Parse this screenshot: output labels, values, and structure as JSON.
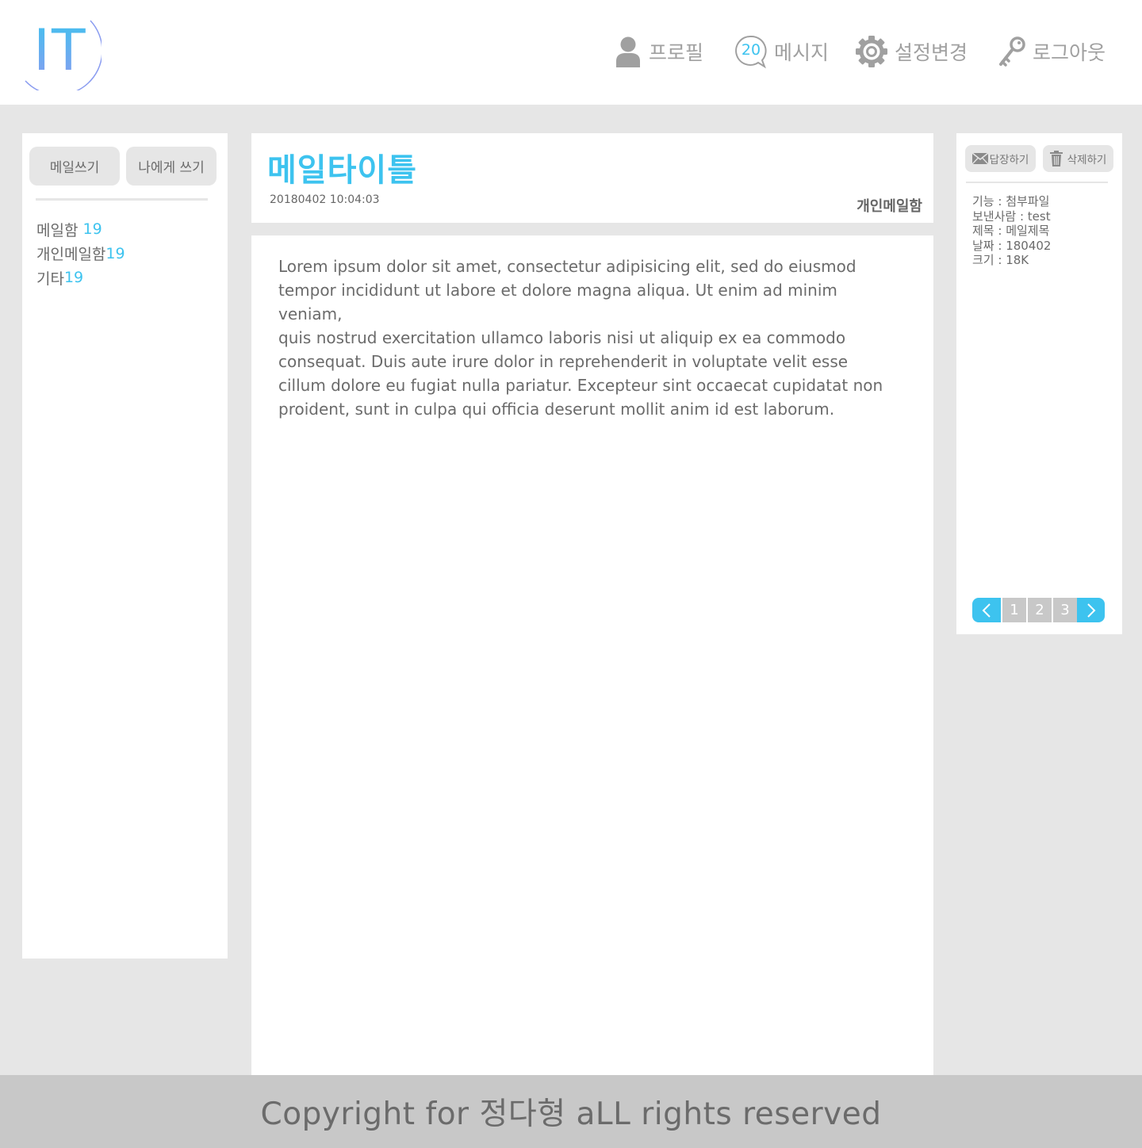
{
  "logo": {
    "text": "IT"
  },
  "nav": [
    {
      "label": "프로필",
      "icon": "user-icon"
    },
    {
      "label": "메시지",
      "icon": "message-bubble-icon",
      "badge": "20"
    },
    {
      "label": "설정변경",
      "icon": "gear-icon"
    },
    {
      "label": "로그아웃",
      "icon": "key-icon"
    }
  ],
  "sidebar": {
    "compose_label": "메일쓰기",
    "self_label": "나에게 쓰기",
    "folders": [
      {
        "label": "메일함 ",
        "count": "19"
      },
      {
        "label": "개인메일함",
        "count": "19"
      },
      {
        "label": "기타",
        "count": "19"
      }
    ]
  },
  "mail": {
    "title": "메일타이틀",
    "date": "20180402 10:04:03",
    "folder": "개인메일함",
    "body": "Lorem ipsum dolor sit amet, consectetur adipisicing elit, sed do eiusmod\ntempor incididunt ut labore et dolore magna aliqua. Ut enim ad minim veniam,\nquis nostrud exercitation ullamco laboris nisi ut aliquip ex ea commodo\nconsequat. Duis aute irure dolor in reprehenderit in voluptate velit esse\ncillum dolore eu fugiat nulla pariatur. Excepteur sint occaecat cupidatat non\nproident, sunt in culpa qui officia deserunt mollit anim id est laborum."
  },
  "panel": {
    "reply_label": "답장하기",
    "delete_label": "삭제하기",
    "info": [
      "기능 : 첨부파일",
      "보낸사람 : test",
      "제목 : 메일제목",
      "날짜 : 180402",
      "크기 : 18K"
    ],
    "pages": [
      "1",
      "2",
      "3"
    ]
  },
  "footer": {
    "text": "Copyright for 정다형 aLL rights reserved"
  },
  "colors": {
    "accent": "#3dc3ef",
    "muted": "#a0a0a0",
    "background": "#e6e6e6",
    "footer": "#c8c8c8"
  }
}
